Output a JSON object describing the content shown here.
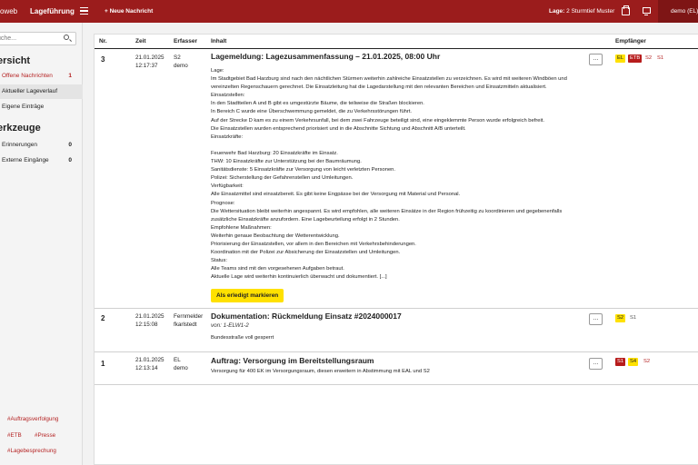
{
  "topbar": {
    "brand_part1": "oweb",
    "brand_part2": "Lageführung",
    "new_message": "+ Neue Nachricht",
    "lage_label": "Lage:",
    "lage_value": "2 Sturmtief Muster",
    "user": "demo (EL)"
  },
  "sidebar": {
    "search_placeholder": "uche...",
    "overview_title": "ersicht",
    "items": [
      {
        "label": "Offene Nachrichten",
        "count": "1"
      },
      {
        "label": "Aktueller Lageverlauf",
        "count": ""
      },
      {
        "label": "Eigene Einträge",
        "count": ""
      }
    ],
    "tools_title": "erkzeuge",
    "tools": [
      {
        "label": "Erinnerungen",
        "count": "0"
      },
      {
        "label": "Externe Eingänge",
        "count": "0"
      }
    ],
    "tags": [
      "#Auftragsverfolgung",
      "#ETB",
      "#Presse",
      "#Lagebesprechung"
    ]
  },
  "table": {
    "headers": {
      "nr": "Nr.",
      "zeit": "Zeit",
      "erfasser": "Erfasser",
      "inhalt": "Inhalt",
      "empfaenger": "Empfänger"
    },
    "rows": [
      {
        "nr": "3",
        "date": "21.01.2025",
        "time": "12:17:37",
        "erfasser1": "S2",
        "erfasser2": "demo",
        "title": "Lagemeldung: Lagezusammenfassung – 21.01.2025, 08:00 Uhr",
        "lines": [
          "Lage:",
          "Im Stadtgebiet Bad Harzburg sind nach den nächtlichen Stürmen weiterhin zahlreiche Einsatzstellen zu verzeichnen. Es wird mit weiteren Windböen und",
          "vereinzelten Regenschauern gerechnet. Die Einsatzleitung hat die Lagedarstellung mit den relevanten Bereichen und Einsatzmitteln aktualisiert.",
          "Einsatzstellen:",
          "In den Stadtteilen A und B gibt es umgestürzte Bäume, die teilweise die Straßen blockieren.",
          "In Bereich C wurde eine Überschwemmung gemeldet, die zu Verkehrsstörungen führt.",
          "Auf der Strecke D kam es zu einem Verkehrsunfall, bei dem zwei Fahrzeuge beteiligt sind, eine eingeklemmte Person wurde erfolgreich befreit.",
          "Die Einsatzstellen wurden entsprechend priorisiert und in die Abschnitte Sichtung und Abschnitt A/B unterteilt.",
          "Einsatzkräfte:",
          "",
          "Feuerwehr Bad Harzburg: 20 Einsatzkräfte im Einsatz.",
          "THW: 10 Einsatzkräfte zur Unterstützung bei der Baumräumung.",
          "Sanitätsdienste: 5 Einsatzkräfte zur Versorgung von leicht verletzten Personen.",
          "Polizei: Sicherstellung der Gefahrenstellen und Umleitungen.",
          "Verfügbarkeit:",
          "Alle Einsatzmittel sind einsatzbereit. Es gibt keine Engpässe bei der Versorgung mit Material und Personal.",
          "Prognose:",
          "Die Wettersituation bleibt weiterhin angespannt. Es wird empfohlen, alle weiteren Einsätze in der Region frühzeitig zu koordinieren und gegebenenfalls",
          "zusätzliche Einsatzkräfte anzufordern. Eine Lagebeurteilung erfolgt in 2 Stunden.",
          "Empfohlene Maßnahmen:",
          "Weiterhin genaue Beobachtung der Wetterentwicklung.",
          "Priorisierung der Einsatzstellen, vor allem in den Bereichen mit Verkehrsbehinderungen.",
          "Koordination mit der Polizei zur Absicherung der Einsatzstellen und Umleitungen.",
          "Status:",
          "Alle Teams sind mit den vorgesehenen Aufgaben betraut.",
          "Aktuelle Lage wird weiterhin kontinuierlich überwacht und dokumentiert. [...]"
        ],
        "done_label": "Als erledigt markieren",
        "recipients": [
          "EL",
          "ETB",
          "S2",
          "S1"
        ]
      },
      {
        "nr": "2",
        "date": "21.01.2025",
        "time": "12:15:08",
        "erfasser1": "Fernmelder",
        "erfasser2": "fkarlstedt",
        "title": "Dokumentation: Rückmeldung Einsatz #2024000017",
        "sub": "von: 1-ELW1-2",
        "lines": [
          "Bundesstraße voll gesperrt"
        ],
        "recipients": [
          "S2",
          "S1"
        ]
      },
      {
        "nr": "1",
        "date": "21.01.2025",
        "time": "12:13:14",
        "erfasser1": "EL",
        "erfasser2": "demo",
        "title": "Auftrag: Versorgung im Bereitstellungsraum",
        "lines": [
          "Versorgung für 400 EK im Versorgungsraum, diesen erweitern in Abstimmung mit EAL und S2"
        ],
        "recipients": [
          "S1",
          "S4",
          "S2"
        ]
      }
    ],
    "more_label": "..."
  }
}
